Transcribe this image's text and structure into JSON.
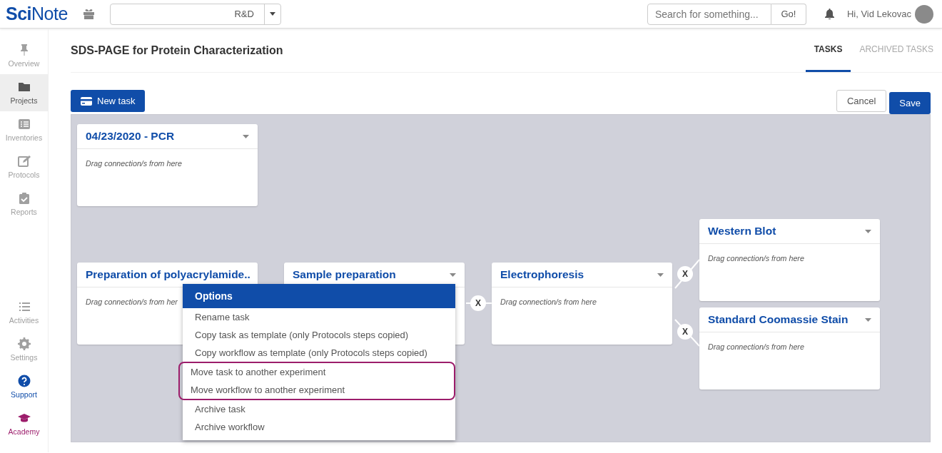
{
  "topbar": {
    "logo": "**Sci**Note",
    "team": "R&D",
    "search": {
      "placeholder": "Search for something..."
    },
    "go": "Go!",
    "greeting": "Hi, Vid Lekovac"
  },
  "sidebar": {
    "items": [
      {
        "label": "Overview",
        "selected": false,
        "color": "#a0a0a0"
      },
      {
        "label": "Projects",
        "selected": true,
        "color": "#555555"
      },
      {
        "label": "Inventories",
        "selected": false,
        "color": "#a0a0a0"
      },
      {
        "label": "Protocols",
        "selected": false,
        "color": "#a0a0a0"
      },
      {
        "label": "Reports",
        "selected": false,
        "color": "#a0a0a0"
      },
      {
        "label": "Activities",
        "selected": false,
        "color": "#a0a0a0"
      },
      {
        "label": "Settings",
        "selected": false,
        "color": "#a0a0a0"
      },
      {
        "label": "Support",
        "selected": false,
        "color": "#104da9"
      },
      {
        "label": "Academy",
        "selected": false,
        "color": "#9c1d6b"
      }
    ]
  },
  "page": {
    "title": "SDS-PAGE for Protein Characterization",
    "tabs": [
      {
        "label": "TASKS",
        "selected": true
      },
      {
        "label": "ARCHIVED TASKS",
        "selected": false
      }
    ],
    "new_task": "New task",
    "cancel": "Cancel",
    "save": "Save"
  },
  "canvas": {
    "tasks": [
      {
        "title": "04/23/2020 - PCR",
        "hint": "Drag connection/s from here"
      },
      {
        "title": "Preparation of polyacrylamide..",
        "hint": "Drag connection/s from her"
      },
      {
        "title": "Sample preparation"
      },
      {
        "title": "Electrophoresis",
        "hint": "Drag connection/s from here"
      },
      {
        "title": "Western Blot",
        "hint": "Drag connection/s from here"
      },
      {
        "title": "Standard Coomassie Stain",
        "hint": "Drag connection/s from here"
      }
    ],
    "connections": [
      {
        "label": "X"
      },
      {
        "label": "X"
      },
      {
        "label": "X"
      }
    ],
    "menu": {
      "title": "Options",
      "items": [
        {
          "label": "Rename task",
          "highlighted": false
        },
        {
          "label": "Copy task as template (only Protocols steps copied)",
          "highlighted": false
        },
        {
          "label": "Copy workflow as template (only Protocols steps copied)",
          "highlighted": false
        },
        {
          "label": "Move task to another experiment",
          "highlighted": true
        },
        {
          "label": "Move workflow to another experiment",
          "highlighted": true
        },
        {
          "label": "Archive task",
          "highlighted": false
        },
        {
          "label": "Archive workflow",
          "highlighted": false
        }
      ]
    }
  }
}
